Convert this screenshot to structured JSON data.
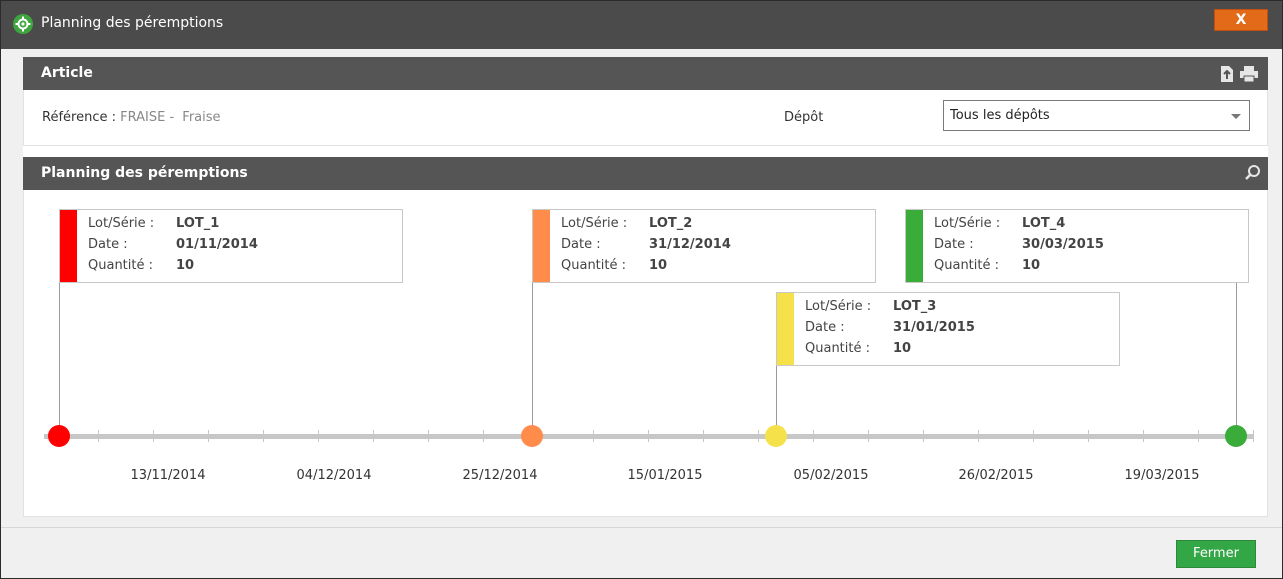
{
  "window": {
    "title": "Planning des péremptions",
    "close_label": "X"
  },
  "article": {
    "header": "Article",
    "reference_label": "Référence :",
    "reference_code": "FRAISE",
    "reference_separator": "-",
    "reference_name": "Fraise",
    "depot_label": "Dépôt",
    "depot_value": "Tous les dépôts"
  },
  "planning": {
    "header": "Planning des péremptions",
    "field_labels": {
      "lot": "Lot/Série :",
      "date": "Date :",
      "qty": "Quantité :"
    },
    "lots": [
      {
        "lot": "LOT_1",
        "date": "01/11/2014",
        "qty": "10",
        "color": "#ff0000"
      },
      {
        "lot": "LOT_2",
        "date": "31/12/2014",
        "qty": "10",
        "color": "#ff8c4b"
      },
      {
        "lot": "LOT_3",
        "date": "31/01/2015",
        "qty": "10",
        "color": "#f5e14a"
      },
      {
        "lot": "LOT_4",
        "date": "30/03/2015",
        "qty": "10",
        "color": "#3aac3a"
      }
    ],
    "axis_labels": [
      "13/11/2014",
      "04/12/2014",
      "25/12/2014",
      "15/01/2015",
      "05/02/2015",
      "26/02/2015",
      "19/03/2015"
    ]
  },
  "footer": {
    "close_button": "Fermer"
  },
  "colors": {
    "titlebar": "#4b4b4b",
    "section_header": "#555555",
    "accent_close": "#e26a19",
    "accent_green": "#33a646"
  }
}
